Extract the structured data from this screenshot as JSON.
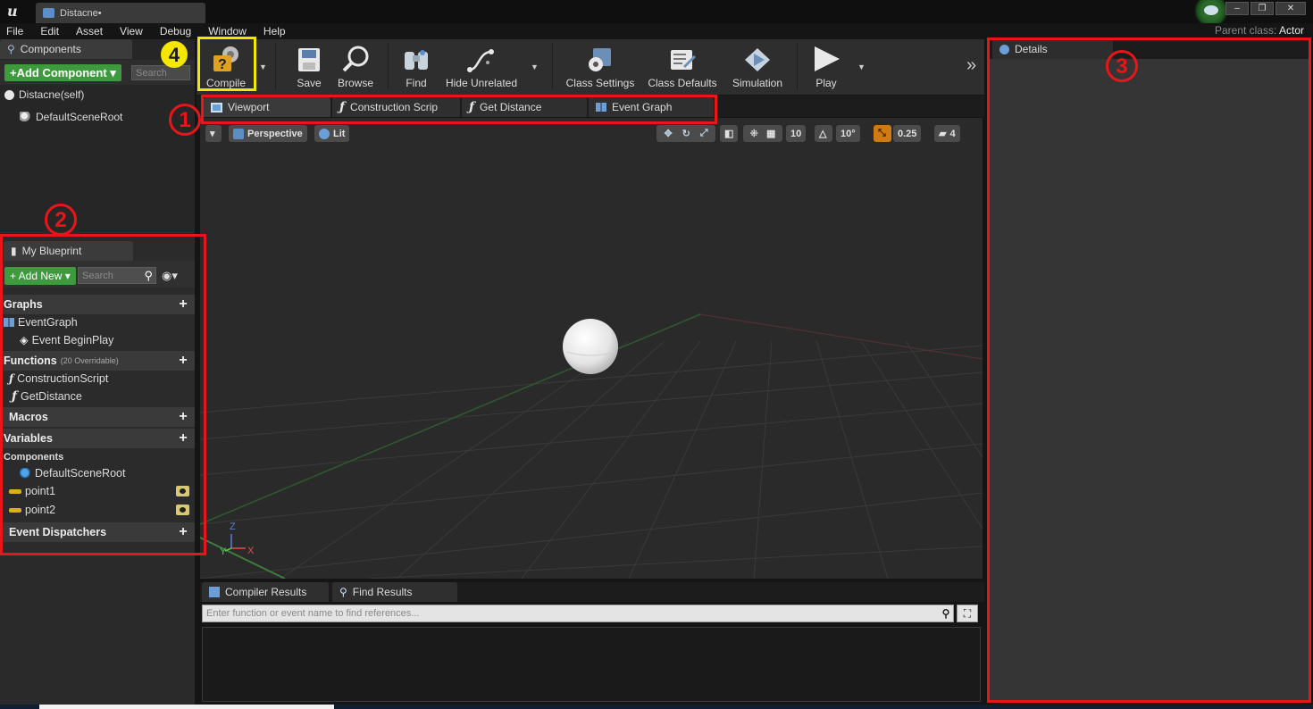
{
  "window": {
    "logo": "u",
    "doc_tab": "Distacne•",
    "buttons": [
      "–",
      "❐",
      "✕"
    ]
  },
  "menu": {
    "items": [
      "File",
      "Edit",
      "Asset",
      "View",
      "Debug",
      "Window",
      "Help"
    ],
    "parent_class_label": "Parent class:",
    "parent_class_value": "Actor"
  },
  "components": {
    "tab": "Components",
    "add_button": "+Add Component ▾",
    "search_placeholder": "Search",
    "self_item": "Distacne(self)",
    "root_item": "DefaultSceneRoot"
  },
  "toolbar": {
    "compile": "Compile",
    "save": "Save",
    "browse": "Browse",
    "find": "Find",
    "hide_unrelated": "Hide Unrelated",
    "class_settings": "Class Settings",
    "class_defaults": "Class Defaults",
    "simulation": "Simulation",
    "play": "Play",
    "overflow": "»"
  },
  "editor_tabs": [
    "Viewport",
    "Construction Scrip",
    "Get Distance",
    "Event Graph"
  ],
  "viewport": {
    "perspective": "Perspective",
    "lit": "Lit",
    "grid_snap": "10",
    "rot_snap": "10°",
    "scale_snap": "0.25",
    "camera_speed": "4",
    "axis_z": "Z",
    "axis_y": "Y",
    "axis_x": "X"
  },
  "my_blueprint": {
    "tab": "My Blueprint",
    "add_new": "+ Add New ▾",
    "search_placeholder": "Search",
    "graphs_header": "Graphs",
    "event_graph": "EventGraph",
    "event_beginplay": "Event BeginPlay",
    "functions_header": "Functions",
    "functions_note": "(20 Overridable)",
    "construction_script": "ConstructionScript",
    "get_distance": "GetDistance",
    "macros_header": "Macros",
    "variables_header": "Variables",
    "components_sub": "Components",
    "default_scene_root": "DefaultSceneRoot",
    "point1": "point1",
    "point2": "point2",
    "dispatchers_header": "Event Dispatchers"
  },
  "bottom": {
    "compiler_results": "Compiler Results",
    "find_results": "Find Results",
    "find_placeholder": "Enter function or event name to find references..."
  },
  "details": {
    "tab": "Details"
  },
  "annotations": {
    "n1": "1",
    "n2": "2",
    "n3": "3",
    "n4": "4",
    "red": "#e8151a",
    "yellow": "#f5e600"
  }
}
